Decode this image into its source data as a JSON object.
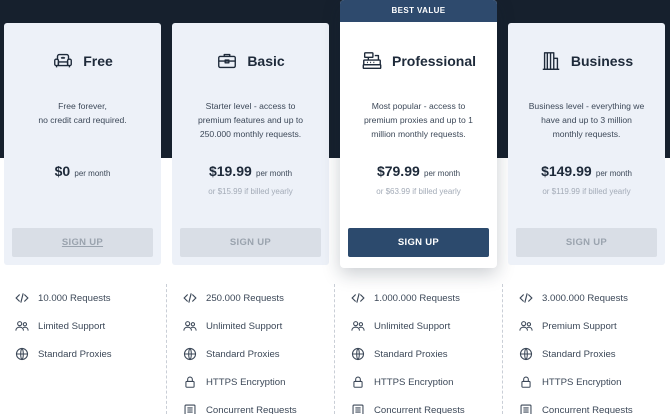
{
  "best_value_label": "BEST VALUE",
  "plans": [
    {
      "name": "Free",
      "icon": "armchair-icon",
      "desc_lines": [
        "Free forever,",
        "no credit card required."
      ],
      "price": "$0",
      "per": "per month",
      "yearly": "",
      "button": "SIGN UP",
      "features": [
        {
          "icon": "code-icon",
          "text": "10.000 Requests"
        },
        {
          "icon": "users-icon",
          "text": "Limited Support"
        },
        {
          "icon": "globe-icon",
          "text": "Standard Proxies"
        }
      ]
    },
    {
      "name": "Basic",
      "icon": "briefcase-icon",
      "desc_lines": [
        "Starter level - access to",
        "premium features and up to",
        "250.000 monthly requests."
      ],
      "price": "$19.99",
      "per": "per month",
      "yearly": "or $15.99 if billed yearly",
      "button": "SIGN UP",
      "features": [
        {
          "icon": "code-icon",
          "text": "250.000 Requests"
        },
        {
          "icon": "users-icon",
          "text": "Unlimited Support"
        },
        {
          "icon": "globe-icon",
          "text": "Standard Proxies"
        },
        {
          "icon": "lock-icon",
          "text": "HTTPS Encryption"
        },
        {
          "icon": "list-icon",
          "text": "Concurrent Requests"
        }
      ]
    },
    {
      "name": "Professional",
      "icon": "cash-register-icon",
      "desc_lines": [
        "Most popular - access to",
        "premium proxies and up to 1",
        "million monthly requests."
      ],
      "price": "$79.99",
      "per": "per month",
      "yearly": "or $63.99 if billed yearly",
      "button": "SIGN UP",
      "features": [
        {
          "icon": "code-icon",
          "text": "1.000.000 Requests"
        },
        {
          "icon": "users-icon",
          "text": "Unlimited Support"
        },
        {
          "icon": "globe-icon",
          "text": "Standard Proxies"
        },
        {
          "icon": "lock-icon",
          "text": "HTTPS Encryption"
        },
        {
          "icon": "list-icon",
          "text": "Concurrent Requests"
        }
      ]
    },
    {
      "name": "Business",
      "icon": "building-icon",
      "desc_lines": [
        "Business level - everything we",
        "have and up to 3 million",
        "monthly requests."
      ],
      "price": "$149.99",
      "per": "per month",
      "yearly": "or $119.99 if billed yearly",
      "button": "SIGN UP",
      "features": [
        {
          "icon": "code-icon",
          "text": "3.000.000 Requests"
        },
        {
          "icon": "users-icon",
          "text": "Premium Support"
        },
        {
          "icon": "globe-icon",
          "text": "Standard Proxies"
        },
        {
          "icon": "lock-icon",
          "text": "HTTPS Encryption"
        },
        {
          "icon": "list-icon",
          "text": "Concurrent Requests"
        }
      ]
    }
  ],
  "colors": {
    "header_band": "#16202d",
    "card_bg": "#edf1f8",
    "highlight_button": "#2c4a6d",
    "best_value_banner": "#2e4a6d",
    "muted_button": "#d9dee6"
  }
}
